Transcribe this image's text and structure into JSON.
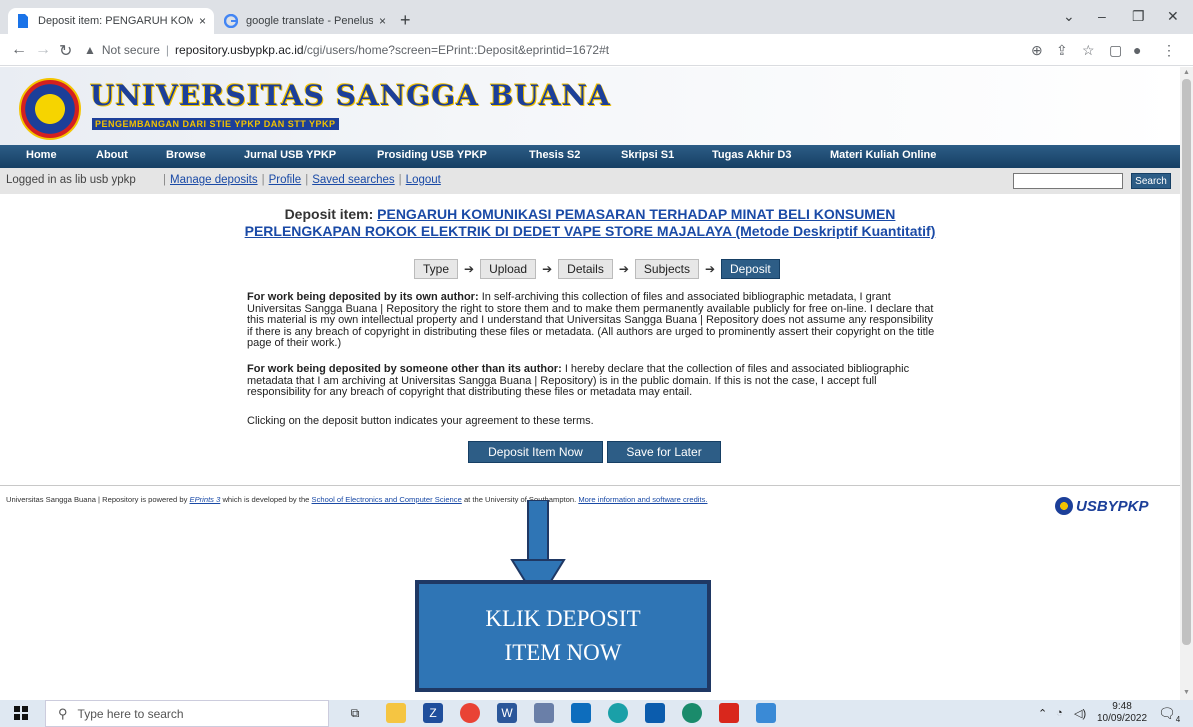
{
  "browser": {
    "tabs": [
      {
        "title": "Deposit item: PENGARUH KOMU",
        "close": "×"
      },
      {
        "title": "google translate - Penelusuran G",
        "close": "×"
      }
    ],
    "new_tab": "+",
    "window_controls": {
      "chevron": "⌄",
      "minimize": "–",
      "restore": "❐",
      "close": "✕"
    },
    "security": "Not secure",
    "url_host": "repository.usbypkp.ac.id",
    "url_path": "/cgi/users/home?screen=EPrint::Deposit&eprintid=1672#t"
  },
  "site": {
    "name": "UNIVERSITAS SANGGA BUANA",
    "tagline": "PENGEMBANGAN DARI STIE YPKP DAN STT YPKP"
  },
  "menu": [
    "Home",
    "About",
    "Browse",
    "Jurnal USB YPKP",
    "Prosiding USB YPKP",
    "Thesis S2",
    "Skripsi S1",
    "Tugas Akhir D3",
    "Materi Kuliah Online"
  ],
  "login": {
    "logged_in": "Logged in as lib usb ypkp",
    "links": [
      "Manage deposits",
      "Profile",
      "Saved searches",
      "Logout"
    ],
    "search_value": "",
    "search_button": "Search"
  },
  "deposit": {
    "title_prefix": "Deposit item:",
    "title_link": "PENGARUH KOMUNIKASI PEMASARAN TERHADAP MINAT BELI KONSUMEN PERLENGKAPAN ROKOK ELEKTRIK DI DEDET VAPE STORE MAJALAYA (Metode Deskriptif Kuantitatif)",
    "steps": [
      "Type",
      "Upload",
      "Details",
      "Subjects",
      "Deposit"
    ],
    "current_step": "Deposit",
    "own_author_heading": "For work being deposited by its own author:",
    "own_author_text": "In self-archiving this collection of files and associated bibliographic metadata, I grant Universitas Sangga Buana | Repository the right to store them and to make them permanently available publicly for free on-line. I declare that this material is my own intellectual property and I understand that Universitas Sangga Buana | Repository does not assume any responsibility if there is any breach of copyright in distributing these files or metadata. (All authors are urged to prominently assert their copyright on the title page of their work.)",
    "other_author_heading": "For work being deposited by someone other than its author:",
    "other_author_text": "I hereby declare that the collection of files and associated bibliographic metadata that I am archiving at Universitas Sangga Buana | Repository) is in the public domain. If this is not the case, I accept full responsibility for any breach of copyright that distributing these files or metadata may entail.",
    "agreement": "Clicking on the deposit button indicates your agreement to these terms.",
    "deposit_button": "Deposit Item Now",
    "save_button": "Save for Later"
  },
  "footer": {
    "prefix": "Universitas Sangga Buana | Repository is powered by",
    "eprints": "EPrints 3",
    "middle": "which is developed by the",
    "school": "School of Electronics and Computer Science",
    "after_school": "at the University of Southampton.",
    "more": "More information and software credits.",
    "logo": "USBYPKP"
  },
  "annotation": {
    "line1": "KLIK DEPOSIT",
    "line2": "ITEM NOW",
    "box_color": "#2f75b5",
    "arrow_color": "#2f75b5"
  },
  "taskbar": {
    "search_placeholder": "Type here to search",
    "time": "9:48",
    "date": "10/09/2022",
    "notifications": "4"
  }
}
